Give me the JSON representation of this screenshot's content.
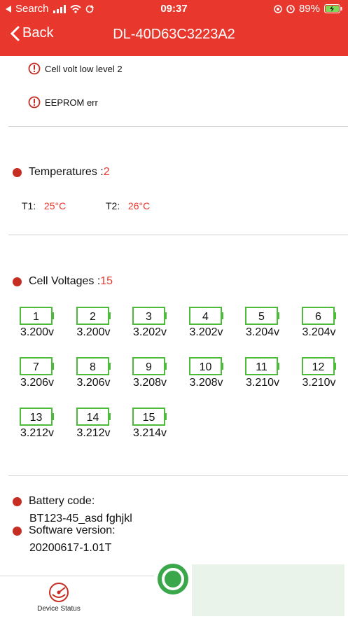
{
  "status_bar": {
    "back_app": "Search",
    "time": "09:37",
    "battery": "89%"
  },
  "nav": {
    "back_label": "Back",
    "title": "DL-40D63C3223A2"
  },
  "alarms": [
    "Cell volt low level 2",
    "EEPROM err"
  ],
  "temperatures": {
    "label": "Temperatures :",
    "count": "2",
    "items": [
      {
        "name": "T1:",
        "value": "25°C"
      },
      {
        "name": "T2:",
        "value": "26°C"
      }
    ]
  },
  "cell_voltages": {
    "label": "Cell Voltages :",
    "count": "15",
    "cells": [
      {
        "num": "1",
        "v": "3.200v"
      },
      {
        "num": "2",
        "v": "3.200v"
      },
      {
        "num": "3",
        "v": "3.202v"
      },
      {
        "num": "4",
        "v": "3.202v"
      },
      {
        "num": "5",
        "v": "3.204v"
      },
      {
        "num": "6",
        "v": "3.204v"
      },
      {
        "num": "7",
        "v": "3.206v"
      },
      {
        "num": "8",
        "v": "3.206v"
      },
      {
        "num": "9",
        "v": "3.208v"
      },
      {
        "num": "10",
        "v": "3.208v"
      },
      {
        "num": "11",
        "v": "3.210v"
      },
      {
        "num": "12",
        "v": "3.210v"
      },
      {
        "num": "13",
        "v": "3.212v"
      },
      {
        "num": "14",
        "v": "3.212v"
      },
      {
        "num": "15",
        "v": "3.214v"
      }
    ]
  },
  "battery_code": {
    "label": "Battery code:",
    "value": "BT123-45_asd fghjkl"
  },
  "software_version": {
    "label": "Software version:",
    "value": "20200617-1.01T"
  },
  "tabbar": {
    "device_status": "Device Status"
  },
  "colors": {
    "accent": "#e8382e",
    "cell_border": "#4cbb3a",
    "dot": "#c62d23"
  }
}
